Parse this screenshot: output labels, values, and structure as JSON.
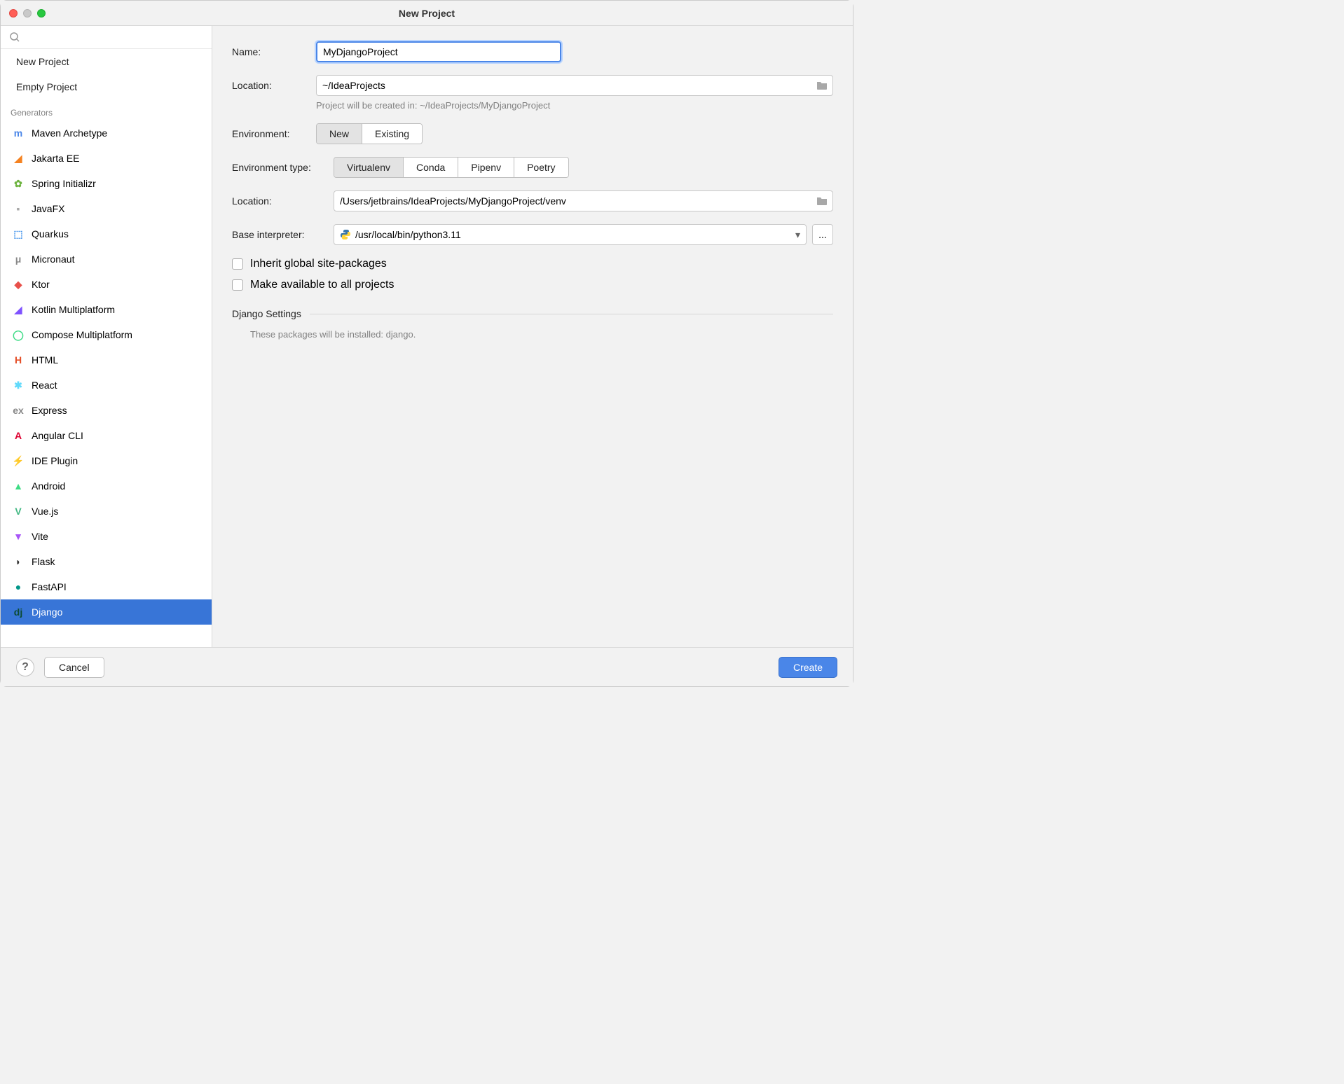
{
  "title": "New Project",
  "sidebar": {
    "projectTypes": [
      {
        "label": "New Project"
      },
      {
        "label": "Empty Project"
      }
    ],
    "generatorsHeader": "Generators",
    "generators": [
      {
        "label": "Maven Archetype",
        "iconColor": "#4a86e8",
        "iconChar": "m"
      },
      {
        "label": "Jakarta EE",
        "iconColor": "#f58220",
        "iconChar": "◢"
      },
      {
        "label": "Spring Initializr",
        "iconColor": "#6db33f",
        "iconChar": "✿"
      },
      {
        "label": "JavaFX",
        "iconColor": "#a8a8a8",
        "iconChar": "▪"
      },
      {
        "label": "Quarkus",
        "iconColor": "#4695eb",
        "iconChar": "⬚"
      },
      {
        "label": "Micronaut",
        "iconColor": "#888",
        "iconChar": "μ"
      },
      {
        "label": "Ktor",
        "iconColor": "#e8504a",
        "iconChar": "◆"
      },
      {
        "label": "Kotlin Multiplatform",
        "iconColor": "#7f52ff",
        "iconChar": "◢"
      },
      {
        "label": "Compose Multiplatform",
        "iconColor": "#3ddb85",
        "iconChar": "◯"
      },
      {
        "label": "HTML",
        "iconColor": "#e44d26",
        "iconChar": "H"
      },
      {
        "label": "React",
        "iconColor": "#61dafb",
        "iconChar": "✱"
      },
      {
        "label": "Express",
        "iconColor": "#888",
        "iconChar": "ex"
      },
      {
        "label": "Angular CLI",
        "iconColor": "#dd0031",
        "iconChar": "A"
      },
      {
        "label": "IDE Plugin",
        "iconColor": "#888",
        "iconChar": "⚡"
      },
      {
        "label": "Android",
        "iconColor": "#3ddc84",
        "iconChar": "▲"
      },
      {
        "label": "Vue.js",
        "iconColor": "#42b883",
        "iconChar": "V"
      },
      {
        "label": "Vite",
        "iconColor": "#a855f7",
        "iconChar": "▼"
      },
      {
        "label": "Flask",
        "iconColor": "#333",
        "iconChar": "◗"
      },
      {
        "label": "FastAPI",
        "iconColor": "#009688",
        "iconChar": "●"
      },
      {
        "label": "Django",
        "iconColor": "#0c4b33",
        "iconChar": "dj",
        "selected": true
      }
    ]
  },
  "form": {
    "nameLabel": "Name:",
    "nameValue": "MyDjangoProject",
    "locationLabel": "Location:",
    "locationValue": "~/IdeaProjects",
    "locationHelp": "Project will be created in: ~/IdeaProjects/MyDjangoProject",
    "environmentLabel": "Environment:",
    "envOptions": [
      "New",
      "Existing"
    ],
    "envSelected": "New",
    "envTypeLabel": "Environment type:",
    "envTypeOptions": [
      "Virtualenv",
      "Conda",
      "Pipenv",
      "Poetry"
    ],
    "envTypeSelected": "Virtualenv",
    "envLocationLabel": "Location:",
    "envLocationValue": "/Users/jetbrains/IdeaProjects/MyDjangoProject/venv",
    "baseInterpreterLabel": "Base interpreter:",
    "baseInterpreterValue": "/usr/local/bin/python3.11",
    "inheritLabel": "Inherit global site-packages",
    "makeAvailableLabel": "Make available to all projects",
    "djangoHeader": "Django Settings",
    "djangoNote": "These packages will be installed: django."
  },
  "footer": {
    "cancel": "Cancel",
    "create": "Create"
  }
}
